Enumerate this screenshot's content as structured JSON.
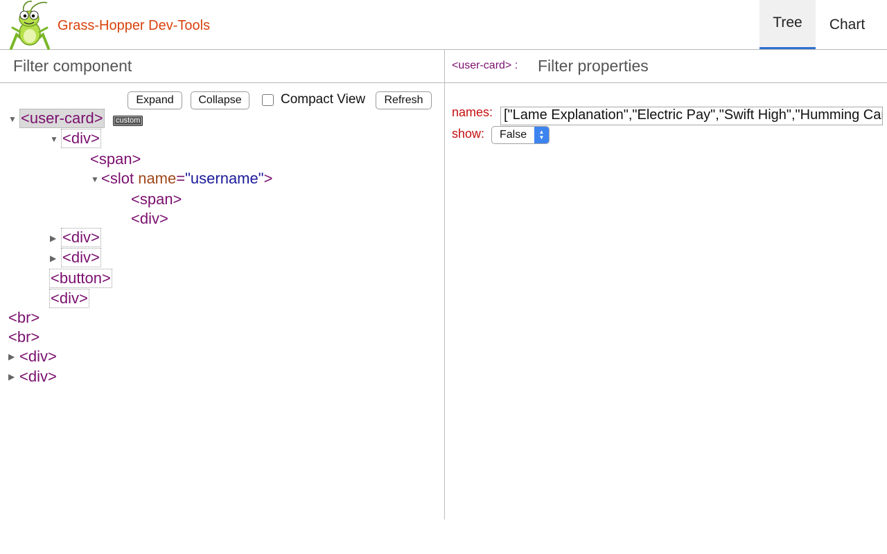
{
  "header": {
    "app_title": "Grass-Hopper Dev-Tools",
    "logo_icon": "grasshopper-logo-icon",
    "tabs": [
      {
        "label": "Tree",
        "active": true
      },
      {
        "label": "Chart",
        "active": false
      }
    ]
  },
  "left_panel": {
    "filter_placeholder": "Filter component",
    "toolbar": {
      "expand_label": "Expand",
      "collapse_label": "Collapse",
      "compact_view_label": "Compact View",
      "compact_view_checked": false,
      "refresh_label": "Refresh"
    },
    "tree": {
      "root_tag": "<user-card>",
      "root_badge": "custom",
      "n_div1": "<div>",
      "n_span1": "<span>",
      "n_slot_open": "<slot ",
      "n_slot_attr": "name",
      "n_slot_eq": "=",
      "n_slot_val": "\"username\"",
      "n_slot_close": ">",
      "n_span2": "<span>",
      "n_div2": "<div>",
      "n_div3": "<div>",
      "n_div4": "<div>",
      "n_button": "<button>",
      "n_div5": "<div>",
      "n_br1": "<br>",
      "n_br2": "<br>",
      "n_div6": "<div>",
      "n_div7": "<div>"
    },
    "colors": {
      "tag": "#7a0f6e",
      "attribute_name": "#a0481c",
      "attribute_value": "#1b1a9a"
    }
  },
  "right_panel": {
    "selected_component": "<user-card> :",
    "filter_placeholder": "Filter properties",
    "properties": {
      "names_label": "names:",
      "names_value": "[\"Lame Explanation\",\"Electric Pay\",\"Swift High\",\"Humming Car",
      "show_label": "show:",
      "show_value": "False"
    },
    "colors": {
      "property_label": "#c41010"
    }
  },
  "accent_color": "#2f6fd0",
  "brand_color": "#d9420c"
}
